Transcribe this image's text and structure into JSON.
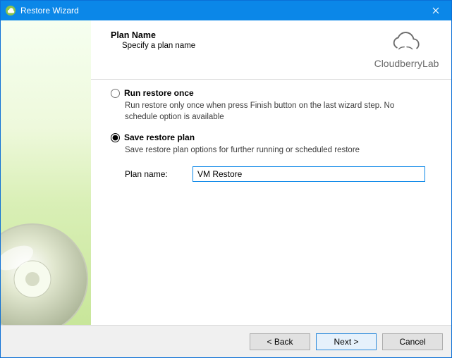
{
  "window": {
    "title": "Restore Wizard"
  },
  "brand": {
    "name": "CloudberryLab"
  },
  "header": {
    "title": "Plan Name",
    "subtitle": "Specify a plan name"
  },
  "options": {
    "run_once": {
      "label": "Run restore once",
      "description": "Run restore only once when press Finish button on the last wizard step. No schedule option is available",
      "selected": false
    },
    "save_plan": {
      "label": "Save restore plan",
      "description": "Save restore plan options for further running or scheduled restore",
      "selected": true
    }
  },
  "plan_name": {
    "label": "Plan name:",
    "value": "VM Restore"
  },
  "footer": {
    "back": "< Back",
    "next": "Next >",
    "cancel": "Cancel"
  }
}
